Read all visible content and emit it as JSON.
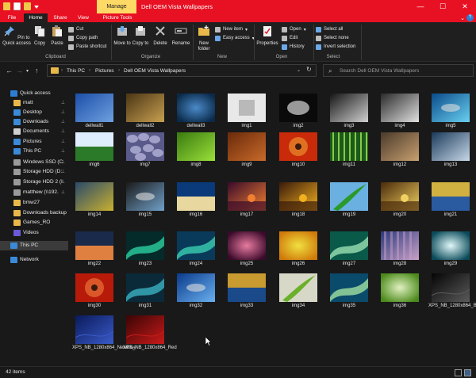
{
  "window": {
    "title": "Dell OEM Vista Wallpapers",
    "context_tab": "Manage",
    "controls": {
      "minimize": "—",
      "maximize": "☐",
      "close": "✕"
    }
  },
  "ribbon_tabs": [
    "File",
    "Home",
    "Share",
    "View",
    "Picture Tools"
  ],
  "ribbon": {
    "clipboard": {
      "label": "Clipboard",
      "pin": "Pin to Quick access",
      "copy": "Copy",
      "paste": "Paste",
      "cut": "Cut",
      "copy_path": "Copy path",
      "paste_shortcut": "Paste shortcut"
    },
    "organize": {
      "label": "Organize",
      "move_to": "Move to",
      "copy_to": "Copy to",
      "delete": "Delete",
      "rename": "Rename"
    },
    "new": {
      "label": "New",
      "new_folder": "New folder",
      "new_item": "New item",
      "easy_access": "Easy access"
    },
    "open": {
      "label": "Open",
      "properties": "Properties",
      "open": "Open",
      "edit": "Edit",
      "history": "History"
    },
    "select": {
      "label": "Select",
      "select_all": "Select all",
      "select_none": "Select none",
      "invert": "Invert selection"
    }
  },
  "address": {
    "crumbs": [
      "This PC",
      "Pictures",
      "Dell OEM Vista Wallpapers"
    ],
    "search_placeholder": "Search Dell OEM Vista Wallpapers"
  },
  "nav_pane": [
    {
      "label": "Quick access",
      "icon": "star-icon",
      "pinned": false,
      "selected": false
    },
    {
      "label": "matt",
      "icon": "folder-icon",
      "pinned": true,
      "selected": false
    },
    {
      "label": "Desktop",
      "icon": "desktop-icon",
      "pinned": true,
      "selected": false
    },
    {
      "label": "Downloads",
      "icon": "download-icon",
      "pinned": true,
      "selected": false
    },
    {
      "label": "Documents",
      "icon": "document-icon",
      "pinned": true,
      "selected": false
    },
    {
      "label": "Pictures",
      "icon": "pictures-icon",
      "pinned": true,
      "selected": false
    },
    {
      "label": "This PC",
      "icon": "pc-icon",
      "pinned": true,
      "selected": false
    },
    {
      "label": "Windows SSD (C",
      "icon": "drive-icon",
      "pinned": true,
      "selected": false
    },
    {
      "label": "Storage HDD (D:",
      "icon": "drive-icon",
      "pinned": true,
      "selected": false
    },
    {
      "label": "Storage HDD 2 (I",
      "icon": "drive-icon",
      "pinned": true,
      "selected": false
    },
    {
      "label": "matthew (\\\\192.",
      "icon": "network-drive-icon",
      "pinned": true,
      "selected": false
    },
    {
      "label": "bmw27",
      "icon": "folder-icon",
      "pinned": false,
      "selected": false
    },
    {
      "label": "Downloads backup",
      "icon": "folder-icon",
      "pinned": false,
      "selected": false
    },
    {
      "label": "Games_RO",
      "icon": "folder-icon",
      "pinned": false,
      "selected": false
    },
    {
      "label": "Videos",
      "icon": "videos-icon",
      "pinned": false,
      "selected": false
    },
    {
      "label": "This PC",
      "icon": "pc-icon",
      "pinned": false,
      "selected": true
    },
    {
      "label": "Network",
      "icon": "network-icon",
      "pinned": false,
      "selected": false
    }
  ],
  "files": [
    {
      "name": "dellwall1",
      "c1": "#1b4fa8",
      "c2": "#6fa0e0",
      "style": "wave"
    },
    {
      "name": "dellwall2",
      "c1": "#4a3514",
      "c2": "#c8a050",
      "style": "swirl"
    },
    {
      "name": "dellwall3",
      "c1": "#0a2a4a",
      "c2": "#4a8ac8",
      "style": "orb"
    },
    {
      "name": "img1",
      "c1": "#e8e8e8",
      "c2": "#9a9a9a",
      "style": "room"
    },
    {
      "name": "img2",
      "c1": "#0a0a0a",
      "c2": "#bdbdbd",
      "style": "leaf"
    },
    {
      "name": "img3",
      "c1": "#151515",
      "c2": "#d0d0d0",
      "style": "noise"
    },
    {
      "name": "img4",
      "c1": "#2a2a2a",
      "c2": "#e0e0e0",
      "style": "noise"
    },
    {
      "name": "img5",
      "c1": "#0a4a8a",
      "c2": "#6ad0f0",
      "style": "fish"
    },
    {
      "name": "img6",
      "c1": "#2a7a2a",
      "c2": "#dfeeff",
      "style": "field"
    },
    {
      "name": "img7",
      "c1": "#5a5a8a",
      "c2": "#a0a0c8",
      "style": "pebbles"
    },
    {
      "name": "img8",
      "c1": "#3a7a10",
      "c2": "#9ae03a",
      "style": "blade"
    },
    {
      "name": "img9",
      "c1": "#6a2a0a",
      "c2": "#c86a2a",
      "style": "wood"
    },
    {
      "name": "img10",
      "c1": "#c82a0a",
      "c2": "#f0a030",
      "style": "flower"
    },
    {
      "name": "img11",
      "c1": "#1a5a1a",
      "c2": "#8ac84a",
      "style": "bamboo"
    },
    {
      "name": "img12",
      "c1": "#4a3a2a",
      "c2": "#c8a070",
      "style": "rock"
    },
    {
      "name": "img13",
      "c1": "#1a3a5a",
      "c2": "#c8d8e8",
      "style": "bridge"
    },
    {
      "name": "img14",
      "c1": "#2a4a6a",
      "c2": "#c8b030",
      "style": "lily"
    },
    {
      "name": "img15",
      "c1": "#1a1a1a",
      "c2": "#70a0c8",
      "style": "fishjump"
    },
    {
      "name": "img16",
      "c1": "#0a3a7a",
      "c2": "#e8d8a0",
      "style": "shore"
    },
    {
      "name": "img17",
      "c1": "#3a0a2a",
      "c2": "#f08030",
      "style": "sunset"
    },
    {
      "name": "img18",
      "c1": "#3a1a0a",
      "c2": "#f0b020",
      "style": "sunset"
    },
    {
      "name": "img19",
      "c1": "#6ab0e0",
      "c2": "#2a9a2a",
      "style": "palm"
    },
    {
      "name": "img20",
      "c1": "#4a2a0a",
      "c2": "#f0d060",
      "style": "sunset"
    },
    {
      "name": "img21",
      "c1": "#2a5aa0",
      "c2": "#d0b040",
      "style": "field2"
    },
    {
      "name": "img22",
      "c1": "#1a2a4a",
      "c2": "#e08040",
      "style": "shore"
    },
    {
      "name": "img23",
      "c1": "#052a2a",
      "c2": "#2ad0a0",
      "style": "aurora"
    },
    {
      "name": "img24",
      "c1": "#0a3a5a",
      "c2": "#3ad0b0",
      "style": "aurora"
    },
    {
      "name": "img25",
      "c1": "#3a0a2a",
      "c2": "#e87aa0",
      "style": "glow"
    },
    {
      "name": "img26",
      "c1": "#d07a0a",
      "c2": "#f0e040",
      "style": "glow"
    },
    {
      "name": "img27",
      "c1": "#0a5a4a",
      "c2": "#9ae0b0",
      "style": "aurora"
    },
    {
      "name": "img28",
      "c1": "#2a3a7a",
      "c2": "#c8a0c8",
      "style": "stripes"
    },
    {
      "name": "img29",
      "c1": "#0a4a5a",
      "c2": "#e0f8f8",
      "style": "glow"
    },
    {
      "name": "img30",
      "c1": "#b81a0a",
      "c2": "#f08040",
      "style": "flower"
    },
    {
      "name": "img31",
      "c1": "#0a2a3a",
      "c2": "#3ab0c0",
      "style": "aurora"
    },
    {
      "name": "img32",
      "c1": "#0a3a8a",
      "c2": "#6ab0f0",
      "style": "fish"
    },
    {
      "name": "img33",
      "c1": "#1a4a8a",
      "c2": "#c89a30",
      "style": "field2"
    },
    {
      "name": "img34",
      "c1": "#d8d8c8",
      "c2": "#6ab02a",
      "style": "palm"
    },
    {
      "name": "img35",
      "c1": "#0a4a6a",
      "c2": "#a0e0a0",
      "style": "aurora"
    },
    {
      "name": "img36",
      "c1": "#4a8a1a",
      "c2": "#e0f0c0",
      "style": "glow"
    },
    {
      "name": "XPS_NB_1280x864_Black",
      "c1": "#050505",
      "c2": "#5a5a5a",
      "style": "xps"
    },
    {
      "name": "XPS_NB_1280x864_NewBlue",
      "c1": "#0a1a5a",
      "c2": "#3a5ac8",
      "style": "xps"
    },
    {
      "name": "XPS_NB_1280x864_Red",
      "c1": "#3a0505",
      "c2": "#c81a1a",
      "style": "xps"
    }
  ],
  "status": {
    "item_count": "42 items"
  }
}
